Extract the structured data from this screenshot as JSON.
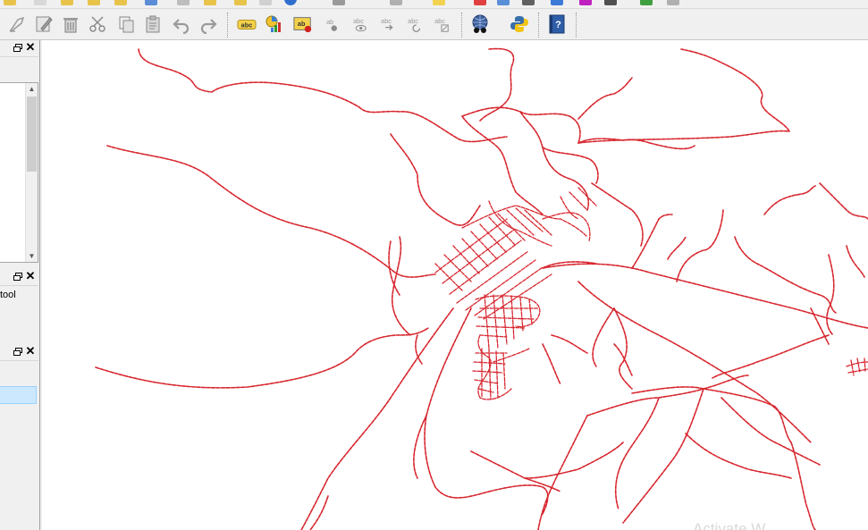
{
  "toolbar": {
    "labeling_icons": [
      "label-abc-icon",
      "diagram-icon",
      "label-pin-icon",
      "label-move-icon",
      "label-show-icon",
      "label-rotate-icon",
      "label-change-icon",
      "label-properties-icon"
    ],
    "label_text": "abc",
    "label_text_short": "ab",
    "help_label": "?"
  },
  "left_panels": {
    "panel2_text": "tool"
  },
  "map": {
    "road_color": "#d7262e",
    "watermark_text": "Activate W"
  },
  "colors": {
    "selection": "#cce8ff",
    "background": "#f0f0f0"
  }
}
